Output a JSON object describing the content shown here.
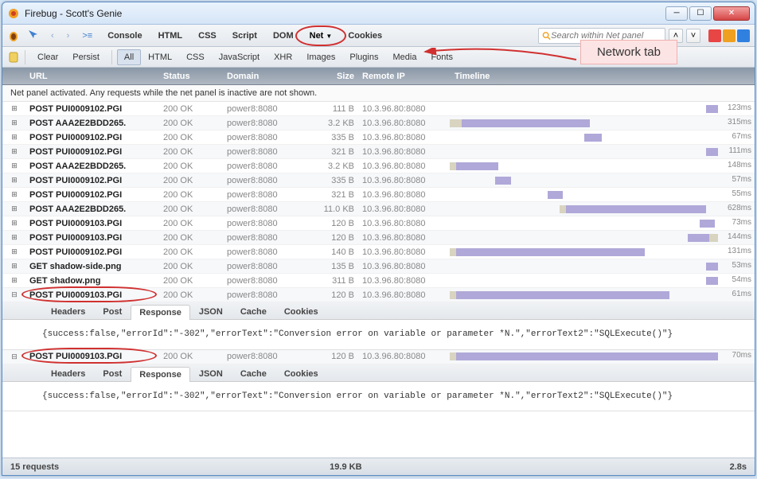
{
  "window": {
    "title": "Firebug - Scott's Genie"
  },
  "toolbar1": {
    "tabs": [
      "Console",
      "HTML",
      "CSS",
      "Script",
      "DOM",
      "Net",
      "Cookies"
    ],
    "active_tab_index": 5,
    "search_placeholder": "Search within Net panel"
  },
  "toolbar2": {
    "buttons": [
      "Clear",
      "Persist"
    ],
    "filters": [
      "All",
      "HTML",
      "CSS",
      "JavaScript",
      "XHR",
      "Images",
      "Plugins",
      "Media",
      "Fonts"
    ],
    "active_filter_index": 0
  },
  "annotation": {
    "label": "Network tab"
  },
  "headers": {
    "url": "URL",
    "status": "Status",
    "domain": "Domain",
    "size": "Size",
    "remote": "Remote IP",
    "timeline": "Timeline"
  },
  "activated_msg": "Net panel activated. Any requests while the net panel is inactive are not shown.",
  "sub_tabs": [
    "Headers",
    "Post",
    "Response",
    "JSON",
    "Cache",
    "Cookies"
  ],
  "sub_tab_active_index": 2,
  "response_body": "{success:false,\"errorId\":\"-302\",\"errorText\":\"Conversion error on variable or parameter *N.\",\"errorText2\":\"SQLExecute()\"}",
  "requests": [
    {
      "method": "POST",
      "url": "PUI0009102.PGI",
      "status": "200 OK",
      "domain": "power8:8080",
      "size": "111 B",
      "remote": "10.3.96.80:8080",
      "tl_start": 84,
      "tl_wait": 0,
      "tl_main": 4,
      "time": "123ms",
      "expanded": false,
      "circled": false
    },
    {
      "method": "POST",
      "url": "AAA2E2BDD265.",
      "status": "200 OK",
      "domain": "power8:8080",
      "size": "3.2 KB",
      "remote": "10.3.96.80:8080",
      "tl_start": 0,
      "tl_wait": 4,
      "tl_main": 42,
      "time": "315ms",
      "expanded": false,
      "circled": false
    },
    {
      "method": "POST",
      "url": "PUI0009102.PGI",
      "status": "200 OK",
      "domain": "power8:8080",
      "size": "335 B",
      "remote": "10.3.96.80:8080",
      "tl_start": 44,
      "tl_wait": 0,
      "tl_main": 6,
      "time": "67ms",
      "expanded": false,
      "circled": false
    },
    {
      "method": "POST",
      "url": "PUI0009102.PGI",
      "status": "200 OK",
      "domain": "power8:8080",
      "size": "321 B",
      "remote": "10.3.96.80:8080",
      "tl_start": 84,
      "tl_wait": 0,
      "tl_main": 4,
      "time": "111ms",
      "expanded": false,
      "circled": false
    },
    {
      "method": "POST",
      "url": "AAA2E2BDD265.",
      "status": "200 OK",
      "domain": "power8:8080",
      "size": "3.2 KB",
      "remote": "10.3.96.80:8080",
      "tl_start": 0,
      "tl_wait": 2,
      "tl_main": 14,
      "time": "148ms",
      "expanded": false,
      "circled": false
    },
    {
      "method": "POST",
      "url": "PUI0009102.PGI",
      "status": "200 OK",
      "domain": "power8:8080",
      "size": "335 B",
      "remote": "10.3.96.80:8080",
      "tl_start": 15,
      "tl_wait": 0,
      "tl_main": 5,
      "time": "57ms",
      "expanded": false,
      "circled": false
    },
    {
      "method": "POST",
      "url": "PUI0009102.PGI",
      "status": "200 OK",
      "domain": "power8:8080",
      "size": "321 B",
      "remote": "10.3.96.80:8080",
      "tl_start": 32,
      "tl_wait": 0,
      "tl_main": 5,
      "time": "55ms",
      "expanded": false,
      "circled": false
    },
    {
      "method": "POST",
      "url": "AAA2E2BDD265.",
      "status": "200 OK",
      "domain": "power8:8080",
      "size": "11.0 KB",
      "remote": "10.3.96.80:8080",
      "tl_start": 36,
      "tl_wait": 2,
      "tl_main": 46,
      "time": "628ms",
      "expanded": false,
      "circled": false
    },
    {
      "method": "POST",
      "url": "PUI0009103.PGI",
      "status": "200 OK",
      "domain": "power8:8080",
      "size": "120 B",
      "remote": "10.3.96.80:8080",
      "tl_start": 82,
      "tl_wait": 0,
      "tl_main": 5,
      "time": "73ms",
      "expanded": false,
      "circled": false
    },
    {
      "method": "POST",
      "url": "PUI0009103.PGI",
      "status": "200 OK",
      "domain": "power8:8080",
      "size": "120 B",
      "remote": "10.3.96.80:8080",
      "tl_start": 78,
      "tl_wait": 0,
      "tl_main": 7,
      "after_wait": 3,
      "time": "144ms",
      "expanded": false,
      "circled": false
    },
    {
      "method": "POST",
      "url": "PUI0009102.PGI",
      "status": "200 OK",
      "domain": "power8:8080",
      "size": "140 B",
      "remote": "10.3.96.80:8080",
      "tl_start": 0,
      "tl_wait": 2,
      "tl_main": 62,
      "time": "131ms",
      "expanded": false,
      "circled": false
    },
    {
      "method": "GET",
      "url": "shadow-side.png",
      "status": "200 OK",
      "domain": "power8:8080",
      "size": "135 B",
      "remote": "10.3.96.80:8080",
      "tl_start": 84,
      "tl_wait": 0,
      "tl_main": 4,
      "time": "53ms",
      "expanded": false,
      "circled": false
    },
    {
      "method": "GET",
      "url": "shadow.png",
      "status": "200 OK",
      "domain": "power8:8080",
      "size": "311 B",
      "remote": "10.3.96.80:8080",
      "tl_start": 84,
      "tl_wait": 0,
      "tl_main": 4,
      "time": "54ms",
      "expanded": false,
      "circled": false
    },
    {
      "method": "POST",
      "url": "PUI0009103.PGI",
      "status": "200 OK",
      "domain": "power8:8080",
      "size": "120 B",
      "remote": "10.3.96.80:8080",
      "tl_start": 0,
      "tl_wait": 2,
      "tl_main": 70,
      "time": "61ms",
      "expanded": true,
      "circled": true
    },
    {
      "method": "POST",
      "url": "PUI0009103.PGI",
      "status": "200 OK",
      "domain": "power8:8080",
      "size": "120 B",
      "remote": "10.3.96.80:8080",
      "tl_start": 0,
      "tl_wait": 2,
      "tl_main": 86,
      "time": "70ms",
      "expanded": true,
      "circled": true
    }
  ],
  "statusbar": {
    "requests": "15 requests",
    "size": "19.9 KB",
    "time": "2.8s"
  }
}
